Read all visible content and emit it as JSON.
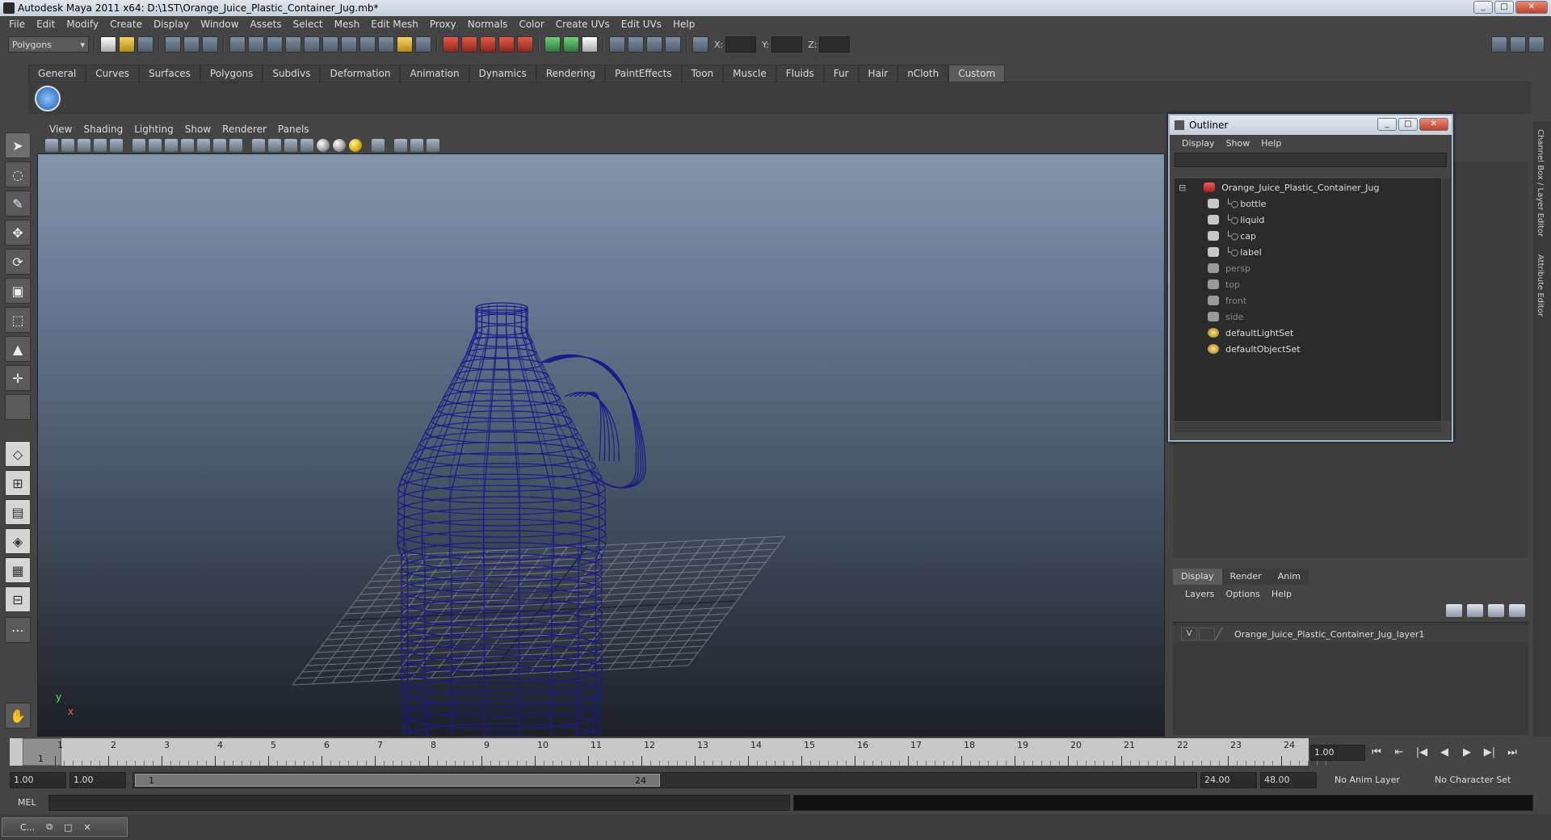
{
  "window": {
    "title": "Autodesk Maya 2011 x64: D:\\1ST\\Orange_Juice_Plastic_Container_Jug.mb*"
  },
  "menubar": [
    "File",
    "Edit",
    "Modify",
    "Create",
    "Display",
    "Window",
    "Assets",
    "Select",
    "Mesh",
    "Edit Mesh",
    "Proxy",
    "Normals",
    "Color",
    "Create UVs",
    "Edit UVs",
    "Help"
  ],
  "statusline": {
    "mode": "Polygons",
    "x_label": "X:",
    "y_label": "Y:",
    "z_label": "Z:"
  },
  "shelf": {
    "tabs": [
      "General",
      "Curves",
      "Surfaces",
      "Polygons",
      "Subdivs",
      "Deformation",
      "Animation",
      "Dynamics",
      "Rendering",
      "PaintEffects",
      "Toon",
      "Muscle",
      "Fluids",
      "Fur",
      "Hair",
      "nCloth",
      "Custom"
    ],
    "active": "Custom"
  },
  "viewport": {
    "menu": [
      "View",
      "Shading",
      "Lighting",
      "Show",
      "Renderer",
      "Panels"
    ],
    "axis_y": "y",
    "axis_x": "x",
    "wire_color": "#1a1a8a"
  },
  "outliner": {
    "title": "Outliner",
    "menu": [
      "Display",
      "Show",
      "Help"
    ],
    "items": [
      {
        "label": "Orange_Juice_Plastic_Container_Jug",
        "type": "group",
        "dim": false
      },
      {
        "label": "bottle",
        "type": "mesh",
        "dim": false
      },
      {
        "label": "liquid",
        "type": "mesh",
        "dim": false
      },
      {
        "label": "cap",
        "type": "mesh",
        "dim": false
      },
      {
        "label": "label",
        "type": "mesh",
        "dim": false
      },
      {
        "label": "persp",
        "type": "camera",
        "dim": true
      },
      {
        "label": "top",
        "type": "camera",
        "dim": true
      },
      {
        "label": "front",
        "type": "camera",
        "dim": true
      },
      {
        "label": "side",
        "type": "camera",
        "dim": true
      },
      {
        "label": "defaultLightSet",
        "type": "set",
        "dim": false
      },
      {
        "label": "defaultObjectSet",
        "type": "set",
        "dim": false
      }
    ]
  },
  "side_tabs": [
    "Channel Box / Layer Editor",
    "Attribute Editor"
  ],
  "layer_editor": {
    "tabs": [
      "Display",
      "Render",
      "Anim"
    ],
    "active": "Display",
    "menu": [
      "Layers",
      "Options",
      "Help"
    ],
    "layer": {
      "visible": "V",
      "name": "Orange_Juice_Plastic_Container_Jug_layer1"
    }
  },
  "timeline": {
    "ticks": [
      "1",
      "2",
      "3",
      "4",
      "5",
      "6",
      "7",
      "8",
      "9",
      "10",
      "11",
      "12",
      "13",
      "14",
      "15",
      "16",
      "17",
      "18",
      "19",
      "20",
      "21",
      "22",
      "23",
      "24"
    ],
    "current_frame": "1",
    "current_frame_field": "1.00"
  },
  "range": {
    "start_time": "1.00",
    "playback_start": "1.00",
    "handle_start": "1",
    "handle_end": "24",
    "playback_end": "24.00",
    "end_time": "48.00",
    "anim_layer": "No Anim Layer",
    "character_set": "No Character Set"
  },
  "cmdline": {
    "label": "MEL"
  },
  "taskbar": {
    "label": "C..."
  }
}
